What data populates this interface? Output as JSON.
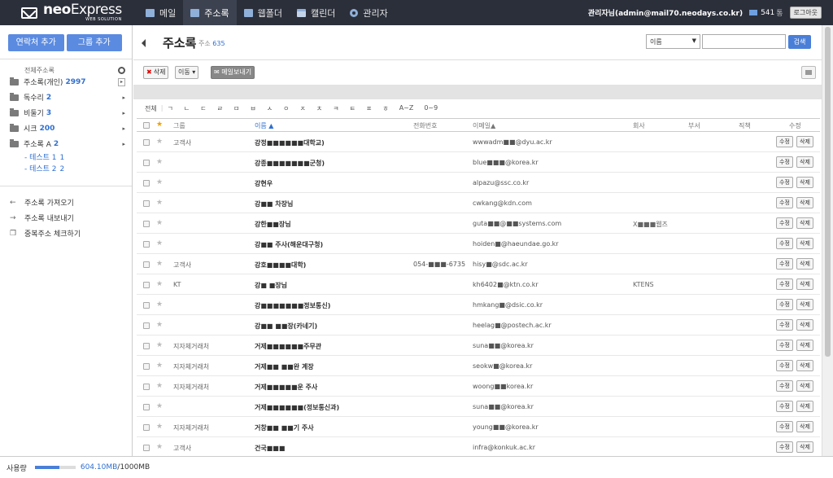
{
  "app": {
    "brand_main": "neo",
    "brand_rest": "Express",
    "brand_sub": "WEB SOLUTION"
  },
  "nav": [
    {
      "label": "메일",
      "icon": "mail-icon",
      "active": false
    },
    {
      "label": "주소록",
      "icon": "address-book-icon",
      "active": true
    },
    {
      "label": "웹폴더",
      "icon": "folder-icon",
      "active": false
    },
    {
      "label": "캘린더",
      "icon": "calendar-icon",
      "active": false
    },
    {
      "label": "관리자",
      "icon": "gear-icon",
      "active": false
    }
  ],
  "topright": {
    "user": "관리자님(admin@mail70.neodays.co.kr)",
    "mail_count": "541",
    "mail_unit": "통",
    "logout": "로그아웃"
  },
  "sidebar": {
    "add_contact": "연락처 추가",
    "add_group": "그룹 추가",
    "all_label": "전체주소록",
    "folders": [
      {
        "label": "주소록(개인)",
        "count": "2997",
        "arrow": "box"
      },
      {
        "label": "독수리",
        "count": "2",
        "arrow": "▸"
      },
      {
        "label": "비둘기",
        "count": "3",
        "arrow": "▸"
      },
      {
        "label": "시크",
        "count": "200",
        "arrow": "▸"
      },
      {
        "label": "주소록 A",
        "count": "2",
        "arrow": "▸"
      }
    ],
    "subs": [
      {
        "label": "- 테스트 1",
        "count": "1"
      },
      {
        "label": "- 테스트 2",
        "count": "2"
      }
    ],
    "tools": [
      {
        "label": "주소록 가져오기",
        "icon": "arrow-left-icon"
      },
      {
        "label": "주소록 내보내기",
        "icon": "arrow-right-icon"
      },
      {
        "label": "중복주소 체크하기",
        "icon": "duplicate-icon"
      }
    ]
  },
  "main": {
    "title": "주소록",
    "count_label": "주소",
    "count": "635",
    "search_select": "이름",
    "search_placeholder": "",
    "search_btn": "검색",
    "delete_btn": "삭제",
    "move_btn": "이동",
    "send_mail_btn": "메일보내기"
  },
  "alpha": [
    "전체",
    "ㄱ",
    "ㄴ",
    "ㄷ",
    "ㄹ",
    "ㅁ",
    "ㅂ",
    "ㅅ",
    "ㅇ",
    "ㅈ",
    "ㅊ",
    "ㅋ",
    "ㅌ",
    "ㅍ",
    "ㅎ",
    "A~Z",
    "0~9"
  ],
  "columns": {
    "group": "그룹",
    "name": "이름 ▲",
    "phone": "전화번호",
    "email": "이메일▲",
    "company": "회사",
    "dept": "부서",
    "position": "직책",
    "edit": "수정"
  },
  "rows": [
    {
      "group": "고객사",
      "name": "강정■■■■■■대학교)",
      "phone": "",
      "email": "wwwadm■■@dyu.ac.kr",
      "company": "",
      "edit": "수정",
      "del": "삭제"
    },
    {
      "group": "",
      "name": "강종■■■■■■■군청)",
      "phone": "",
      "email": "blue■■■@korea.kr",
      "company": "",
      "edit": "수정",
      "del": "삭제"
    },
    {
      "group": "",
      "name": "강현우",
      "phone": "",
      "email": "alpazu@ssc.co.kr",
      "company": "",
      "edit": "수정",
      "del": "삭제"
    },
    {
      "group": "",
      "name": "강■■ 차장님",
      "phone": "",
      "email": "cwkang@kdn.com",
      "company": "",
      "edit": "수정",
      "del": "삭제"
    },
    {
      "group": "",
      "name": "강한■■장님",
      "phone": "",
      "email": "guta■■@■■systems.com",
      "company": "X■■■웹즈",
      "edit": "수정",
      "del": "삭제"
    },
    {
      "group": "",
      "name": "강■■ 주사(해운대구청)",
      "phone": "",
      "email": "hoiden■@haeundae.go.kr",
      "company": "",
      "edit": "수정",
      "del": "삭제"
    },
    {
      "group": "고객사",
      "name": "강호■■■■대학)",
      "phone": "054-■■■-6735",
      "email": "hisy■@sdc.ac.kr",
      "company": "",
      "edit": "수정",
      "del": "삭제"
    },
    {
      "group": "KT",
      "name": "강■ ■장님",
      "phone": "",
      "email": "kh6402■@ktn.co.kr",
      "company": "KTENS",
      "edit": "수정",
      "del": "삭제"
    },
    {
      "group": "",
      "name": "강■■■■■■■정보통신)",
      "phone": "",
      "email": "hmkang■@dsic.co.kr",
      "company": "",
      "edit": "수정",
      "del": "삭제"
    },
    {
      "group": "",
      "name": "강■■ ■■장(카네기)",
      "phone": "",
      "email": "heelag■@postech.ac.kr",
      "company": "",
      "edit": "수정",
      "del": "삭제"
    },
    {
      "group": "지자체거래처",
      "name": "거제■■■■■■주무관",
      "phone": "",
      "email": "suna■■@korea.kr",
      "company": "",
      "edit": "수정",
      "del": "삭제"
    },
    {
      "group": "지자체거래처",
      "name": "거제■■ ■■완 계장",
      "phone": "",
      "email": "seokw■@korea.kr",
      "company": "",
      "edit": "수정",
      "del": "삭제"
    },
    {
      "group": "지자체거래처",
      "name": "거제■■■■■운 주사",
      "phone": "",
      "email": "woong■■korea.kr",
      "company": "",
      "edit": "수정",
      "del": "삭제"
    },
    {
      "group": "",
      "name": "거제■■■■■■(정보통신과)",
      "phone": "",
      "email": "suna■■@korea.kr",
      "company": "",
      "edit": "수정",
      "del": "삭제"
    },
    {
      "group": "지자체거래처",
      "name": "거창■■ ■■기 주사",
      "phone": "",
      "email": "young■■@korea.kr",
      "company": "",
      "edit": "수정",
      "del": "삭제"
    },
    {
      "group": "고객사",
      "name": "건국■■■",
      "phone": "",
      "email": "infra@konkuk.ac.kr",
      "company": "",
      "edit": "수정",
      "del": "삭제"
    }
  ],
  "footer": {
    "label": "사용량",
    "used": "604.10MB",
    "sep": " / ",
    "total": "1000MB",
    "used_fraction": 0.604
  }
}
